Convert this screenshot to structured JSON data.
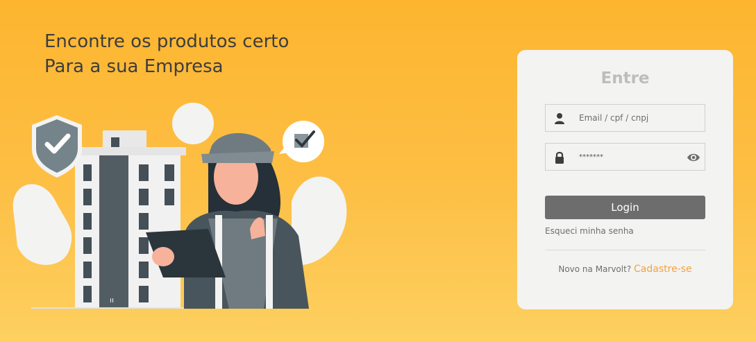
{
  "hero": {
    "line1": "Encontre os produtos certo",
    "line2": "Para a sua Empresa"
  },
  "login": {
    "title": "Entre",
    "email_placeholder": "Email / cpf / cnpj",
    "email_icon": "user-icon",
    "password_value": "*******",
    "password_icon": "lock-icon",
    "toggle_icon": "eye-icon",
    "submit_label": "Login",
    "forgot_label": "Esqueci minha senha",
    "signup_prompt": "Novo na Marvolt?",
    "signup_link": "Cadastre-se"
  },
  "colors": {
    "background": "#fdb52f",
    "card": "#f3f3f2",
    "button": "#6d6d6d",
    "link_accent": "#f5a23b",
    "headline": "#3d3d3d"
  }
}
